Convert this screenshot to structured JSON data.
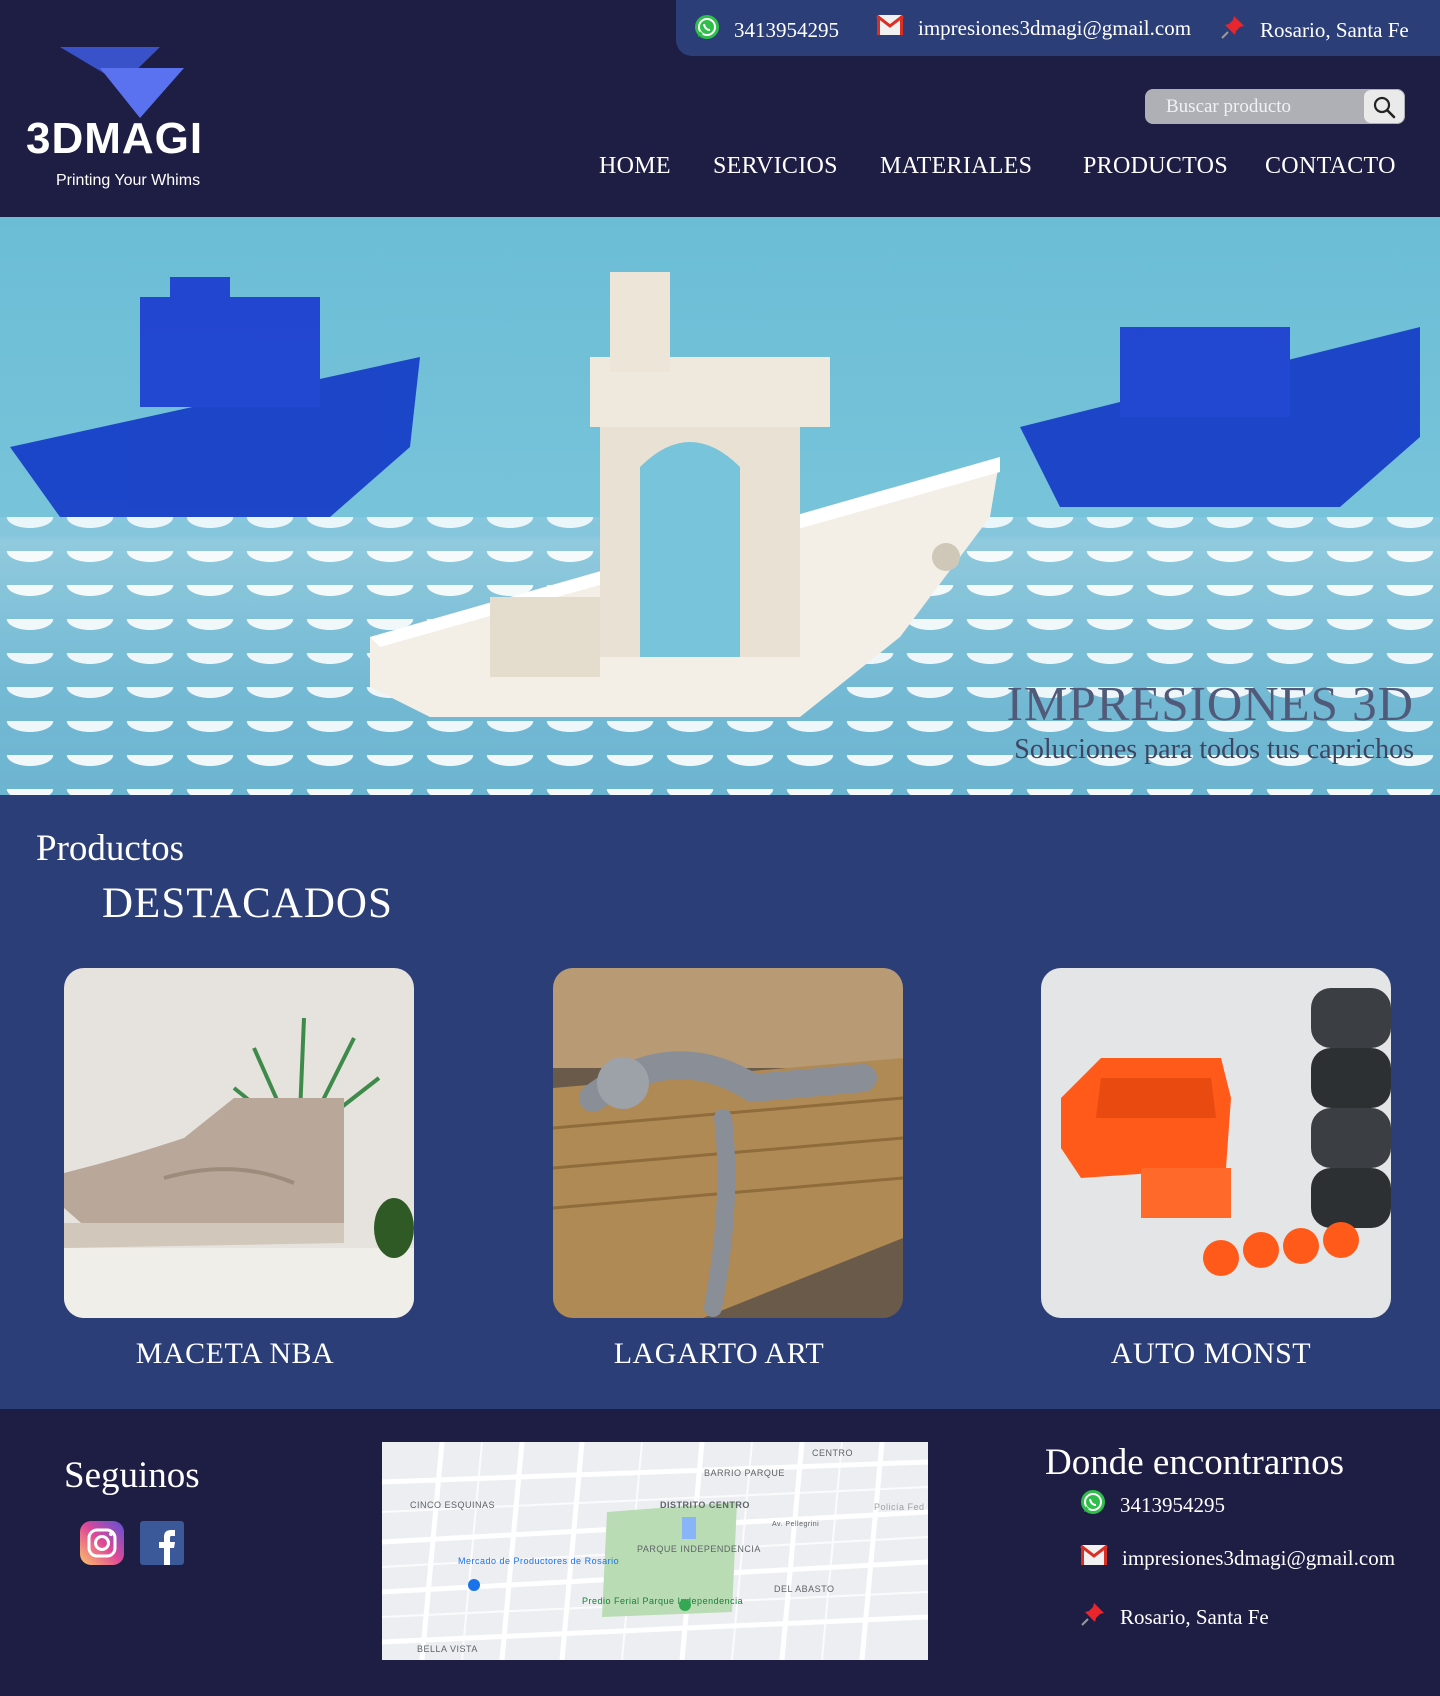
{
  "contact": {
    "phone": "3413954295",
    "email": "impresiones3dmagi@gmail.com",
    "location": "Rosario, Santa Fe"
  },
  "brand": {
    "name": "3DMAGI",
    "tagline": "Printing Your Whims"
  },
  "search": {
    "placeholder": "Buscar producto"
  },
  "nav": {
    "items": [
      "HOME",
      "SERVICIOS",
      "MATERIALES",
      "PRODUCTOS",
      "CONTACTO"
    ]
  },
  "hero": {
    "title": "IMPRESIONES 3D",
    "subtitle": "Soluciones para todos tus caprichos"
  },
  "products": {
    "title": "Productos",
    "subtitle": "DESTACADOS",
    "items": [
      {
        "label": "MACETA NBA"
      },
      {
        "label": "LAGARTO ART"
      },
      {
        "label": "AUTO MONST"
      }
    ]
  },
  "footer": {
    "follow_title": "Seguinos",
    "find_title": "Donde encontrarnos",
    "map_labels": [
      "CENTRO",
      "BARRIO PARQUE",
      "CINCO ESQUINAS",
      "DISTRITO CENTRO",
      "PARQUE INDEPENDENCIA",
      "Mercado de Productores de Rosario",
      "DEL ABASTO",
      "Predio Ferial Parque Independencia",
      "BELLA VISTA",
      "Av. Pellegrini",
      "Policía Fed"
    ]
  },
  "colors": {
    "header_bg": "#1e1e45",
    "contact_bar_bg": "#2c3e78",
    "products_bg": "#2c3e78",
    "hero_text": "#515a78"
  },
  "icons": [
    "whatsapp-icon",
    "gmail-icon",
    "pushpin-icon",
    "search-icon",
    "instagram-icon",
    "facebook-icon"
  ]
}
